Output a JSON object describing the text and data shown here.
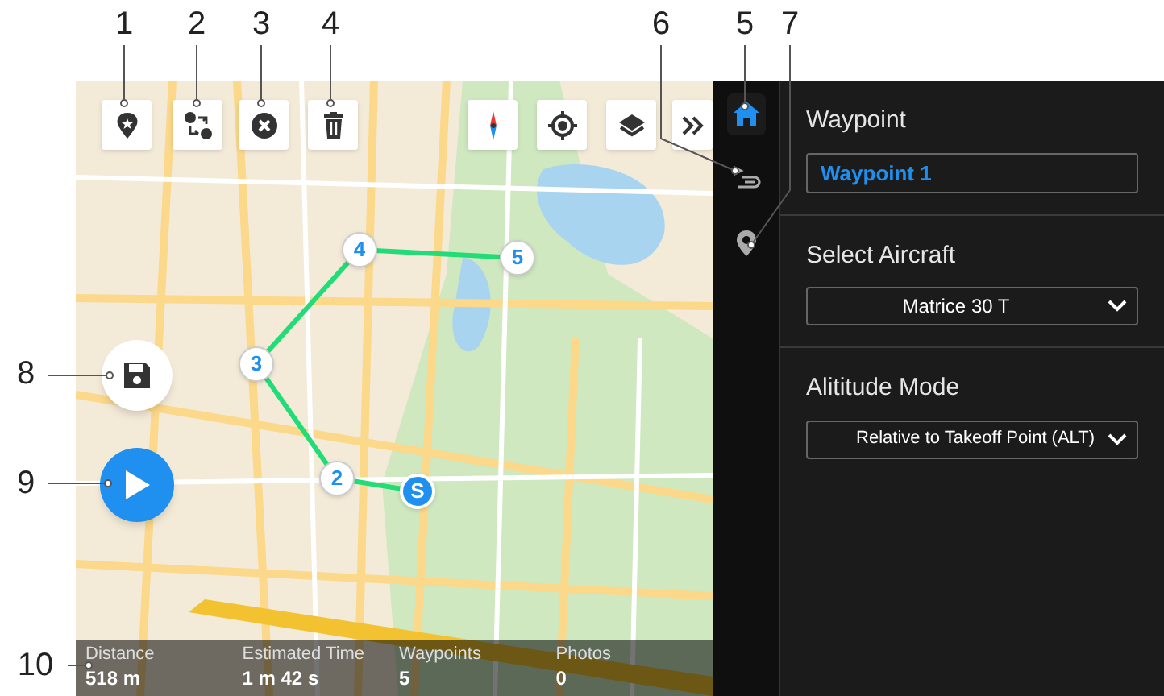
{
  "callouts": [
    {
      "label": "1"
    },
    {
      "label": "2"
    },
    {
      "label": "3"
    },
    {
      "label": "4"
    },
    {
      "label": "6"
    },
    {
      "label": "5"
    },
    {
      "label": "7"
    },
    {
      "label": "8"
    },
    {
      "label": "9"
    },
    {
      "label": "10"
    }
  ],
  "map": {
    "waypoints": [
      {
        "kind": "start",
        "label": "S"
      },
      {
        "kind": "waypoint",
        "label": "2"
      },
      {
        "kind": "waypoint",
        "label": "3"
      },
      {
        "kind": "waypoint",
        "label": "4"
      },
      {
        "kind": "waypoint",
        "label": "5"
      }
    ]
  },
  "sidebar": {
    "items": [
      {
        "kind": "home",
        "selected": true
      },
      {
        "kind": "route",
        "selected": false
      },
      {
        "kind": "pin",
        "selected": false
      }
    ]
  },
  "panel": {
    "waypoint": {
      "label": "Waypoint",
      "value": "Waypoint 1"
    },
    "aircraft": {
      "label": "Select Aircraft",
      "value": "Matrice 30 T"
    },
    "altitude_mode": {
      "label": "Alititude Mode",
      "value": "Relative to Takeoff Point (ALT)"
    }
  },
  "stats": [
    {
      "label": "Distance",
      "value": "518 m"
    },
    {
      "label": "Estimated Time",
      "value": "1 m 42 s"
    },
    {
      "label": "Waypoints",
      "value": "5"
    },
    {
      "label": "Photos",
      "value": "0"
    }
  ]
}
